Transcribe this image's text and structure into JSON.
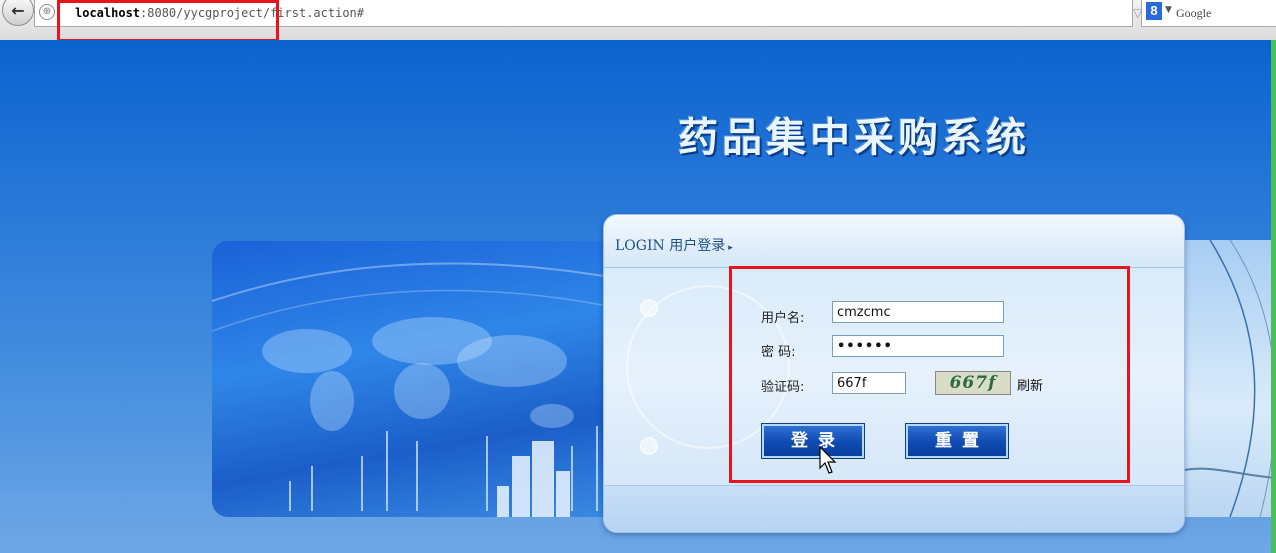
{
  "browser": {
    "url_host": "localhost",
    "url_rest": ":8080/yycgproject/first.action#",
    "search_engine": "Google",
    "back_icon": "back-arrow-icon",
    "reload_icon": "reload-icon",
    "google_logo": "8"
  },
  "page": {
    "system_title": "药品集中采购系统"
  },
  "login": {
    "title": "LOGIN 用户登录",
    "title_caret": "▸",
    "username_label": "用户名:",
    "username_value": "cmzcmc",
    "password_label": "密 码:",
    "password_value": "••••••",
    "captcha_label": "验证码:",
    "captcha_value": "667f",
    "captcha_image_text": "667f",
    "refresh_label": "刷新",
    "login_button": "登录",
    "reset_button": "重置"
  },
  "colors": {
    "highlight": "#e8131c",
    "page_blue": "#1f6fd1",
    "button_blue": "#0f4ab2"
  }
}
